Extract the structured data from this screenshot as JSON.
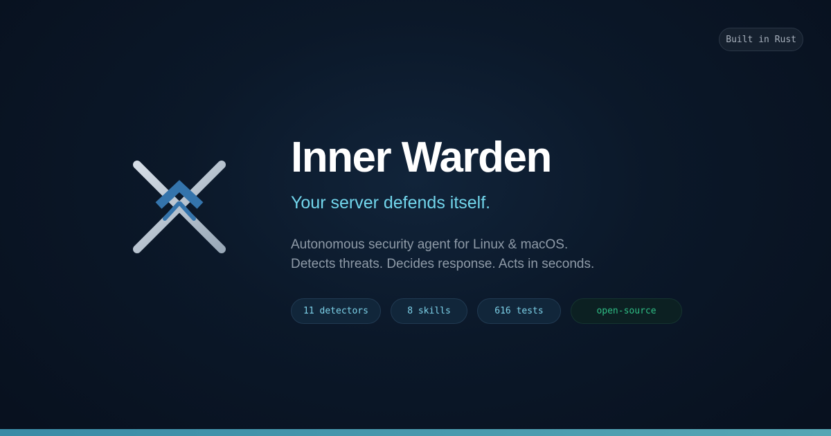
{
  "badge": {
    "label": "Built in Rust"
  },
  "logo": {
    "icon": "shield-crossed-swords-icon"
  },
  "hero": {
    "title": "Inner Warden",
    "tagline": "Your server defends itself.",
    "description_lines": [
      "Autonomous security agent for Linux & macOS.",
      "Detects threats. Decides response. Acts in seconds."
    ]
  },
  "chips": [
    {
      "label": "11 detectors"
    },
    {
      "label": "8 skills"
    },
    {
      "label": "616 tests"
    },
    {
      "label": "open-source"
    }
  ],
  "colors": {
    "background": "#0b1829",
    "accent": "#72d6ec",
    "open_source": "#2fbf86",
    "bottom_bar": "#4a9aaf"
  }
}
